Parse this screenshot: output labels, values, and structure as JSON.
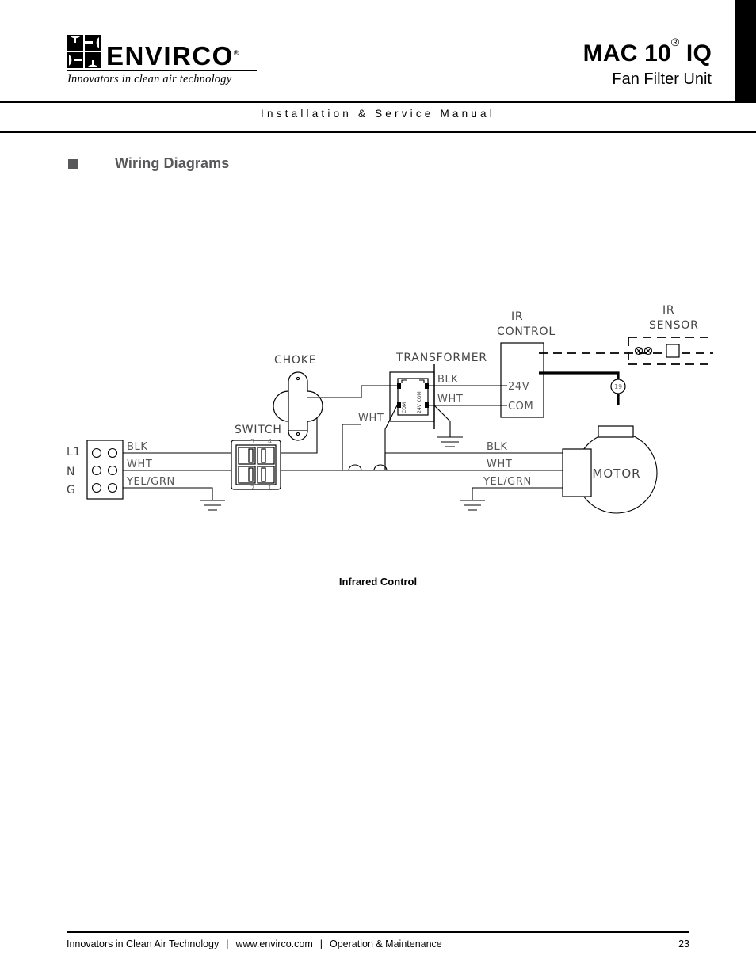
{
  "header": {
    "logo": {
      "brand": "ENVIRCO",
      "registered_mark": "®",
      "tagline": "Innovators in clean air technology",
      "mark_icon": "envirco-quadrant-logo"
    },
    "product_title": "MAC 10",
    "product_title_sup": "®",
    "product_title_suffix": " IQ",
    "product_subtitle": "Fan Filter Unit",
    "manual_line": "Installation & Service Manual",
    "accent_bar_color": "#000000"
  },
  "section": {
    "bullet": "■",
    "bullet_color": "#58585a",
    "title": "Wiring Diagrams"
  },
  "diagram": {
    "caption": "Infrared Control",
    "labels": {
      "choke": "CHOKE",
      "switch": "SWITCH",
      "transformer": "TRANSFORMER",
      "ir_control_line1": "IR",
      "ir_control_line2": "CONTROL",
      "ir_sensor_line1": "IR",
      "ir_sensor_line2": "SENSOR",
      "motor": "MOTOR"
    },
    "terminal_block": {
      "rows": [
        "L1",
        "N",
        "G"
      ]
    },
    "switch_terminals": {
      "top_left": "5",
      "top_right": "4",
      "bottom_left": "2",
      "bottom_right": "1"
    },
    "transformer_terminals": {
      "primary": "COM",
      "secondary": "24V COM"
    },
    "ir_control_terminals": {
      "v24": "24V",
      "com": "COM"
    },
    "wire_labels": {
      "supply_blk": "BLK",
      "supply_wht": "WHT",
      "supply_gnd": "YEL/GRN",
      "transformer_out_blk": "BLK",
      "transformer_out_wht": "WHT",
      "transformer_in_wht": "WHT",
      "motor_blk": "BLK",
      "motor_wht": "WHT",
      "motor_gnd": "YEL/GRN"
    },
    "node_marker": "19"
  },
  "footer": {
    "tagline": "Innovators in Clean Air Technology",
    "separator": "|",
    "website": "www.envirco.com",
    "document": "Operation & Maintenance",
    "page_number": "23"
  }
}
